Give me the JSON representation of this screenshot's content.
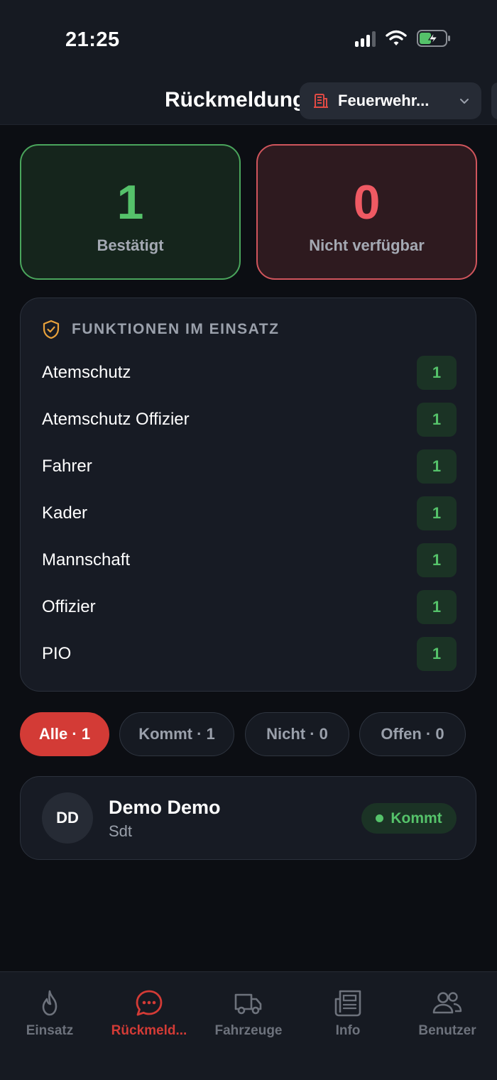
{
  "status_bar": {
    "time": "21:25"
  },
  "header": {
    "title": "Rückmeldung",
    "station_selector": {
      "label": "Feuerwehr..."
    }
  },
  "summary": {
    "confirmed": {
      "count": "1",
      "label": "Bestätigt",
      "color": "#55c26a"
    },
    "unavailable": {
      "count": "0",
      "label": "Nicht verfügbar",
      "color": "#ef5a63"
    }
  },
  "functions": {
    "title": "FUNKTIONEN IM EINSATZ",
    "items": [
      {
        "name": "Atemschutz",
        "count": "1"
      },
      {
        "name": "Atemschutz Offizier",
        "count": "1"
      },
      {
        "name": "Fahrer",
        "count": "1"
      },
      {
        "name": "Kader",
        "count": "1"
      },
      {
        "name": "Mannschaft",
        "count": "1"
      },
      {
        "name": "Offizier",
        "count": "1"
      },
      {
        "name": "PIO",
        "count": "1"
      }
    ]
  },
  "filters": [
    {
      "label": "Alle · 1",
      "active": true
    },
    {
      "label": "Kommt · 1",
      "active": false
    },
    {
      "label": "Nicht · 0",
      "active": false
    },
    {
      "label": "Offen · 0",
      "active": false
    }
  ],
  "responders": [
    {
      "initials": "DD",
      "name": "Demo Demo",
      "role": "Sdt",
      "status": "Kommt"
    }
  ],
  "nav": {
    "items": [
      {
        "label": "Einsatz",
        "icon": "flame-icon"
      },
      {
        "label": "Rückmeld...",
        "icon": "chat-bubble-icon",
        "active": true
      },
      {
        "label": "Fahrzeuge",
        "icon": "truck-icon"
      },
      {
        "label": "Info",
        "icon": "newspaper-icon"
      },
      {
        "label": "Benutzer",
        "icon": "users-icon"
      }
    ]
  },
  "colors": {
    "accent": "#d33b36",
    "background": "#0c0e13",
    "panel": "#171b24"
  }
}
